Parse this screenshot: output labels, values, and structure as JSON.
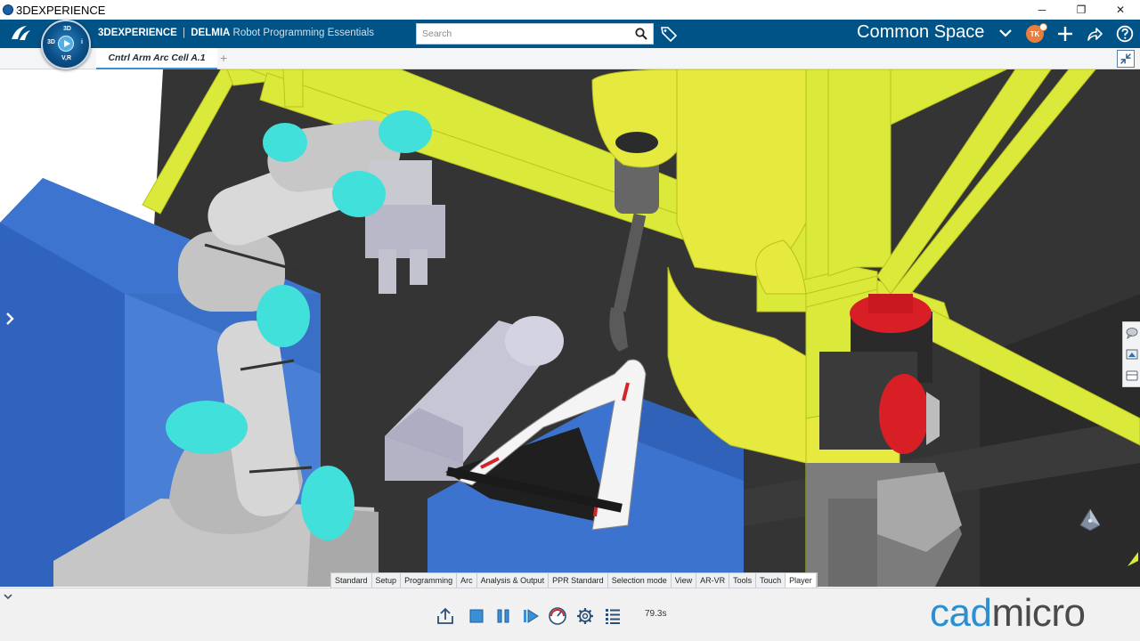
{
  "window": {
    "title": "3DEXPERIENCE",
    "minimize_glyph": "─",
    "restore_glyph": "❐",
    "close_glyph": "✕"
  },
  "header": {
    "brand_3dx": "3DEXPERIENCE",
    "brand_sep": "|",
    "brand_delmia": "DELMIA",
    "brand_product": "Robot Programming Essentials",
    "compass_labels": {
      "top": "3D",
      "left": "3D",
      "bottom": "V,R",
      "right": "i"
    },
    "search_placeholder": "Search",
    "space_title": "Common Space",
    "avatar_initials": "TK",
    "icons": [
      "search-icon",
      "tag-icon",
      "chevron-down-icon",
      "add-icon",
      "share-icon",
      "help-icon"
    ]
  },
  "tabs": {
    "active_label": "Cntrl Arm Arc Cell A.1",
    "add_glyph": "+"
  },
  "section_tabs": [
    "Standard",
    "Setup",
    "Programming",
    "Arc",
    "Analysis & Output",
    "PPR Standard",
    "Selection mode",
    "View",
    "AR-VR",
    "Tools",
    "Touch",
    "Player"
  ],
  "section_tabs_active": "Player",
  "action_bar": {
    "time_readout": "79.3s",
    "icons": [
      "export-icon",
      "stop-icon",
      "pause-icon",
      "step-play-icon",
      "speed-gauge-icon",
      "settings-icon",
      "list-icon"
    ]
  },
  "watermark": {
    "part1": "cad",
    "part2": "micro"
  },
  "colors": {
    "header_bg": "#005386",
    "frame_yellow": "#dcec3c",
    "robot_yellow": "#e6ea3f",
    "table_blue": "#3a6fc8",
    "cobot_cyan": "#3de3dc",
    "watermark_blue": "#2b8fd0"
  }
}
